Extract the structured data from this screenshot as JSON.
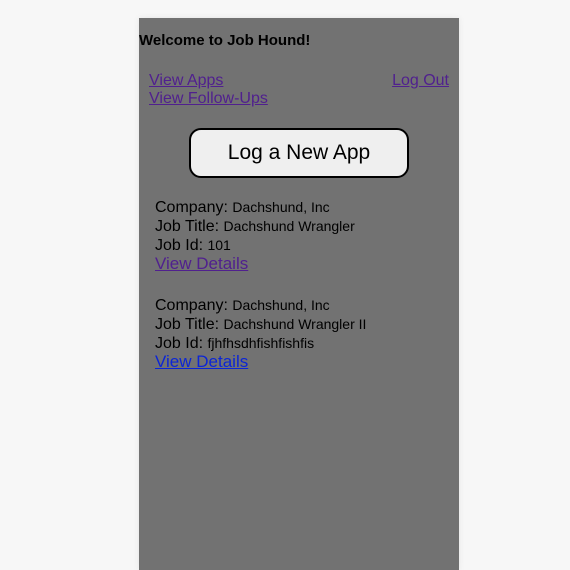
{
  "header": {
    "welcome": "Welcome to Job Hound!"
  },
  "nav": {
    "view_apps": "View Apps",
    "view_followups": "View Follow-Ups",
    "log_out": "Log Out"
  },
  "actions": {
    "log_new_app": "Log a New App"
  },
  "labels": {
    "company": "Company:",
    "job_title": "Job Title:",
    "job_id": "Job Id:",
    "view_details": "View Details"
  },
  "apps": [
    {
      "company": "Dachshund, Inc",
      "job_title": "Dachshund Wrangler",
      "job_id": "101"
    },
    {
      "company": "Dachshund, Inc",
      "job_title": "Dachshund Wrangler II",
      "job_id": "fjhfhsdhfishfishfis"
    }
  ],
  "colors": {
    "panel_bg": "#727272",
    "page_bg": "#f7f7f7",
    "link_visited": "#50208e",
    "link_unvisited": "#0b25d6"
  }
}
